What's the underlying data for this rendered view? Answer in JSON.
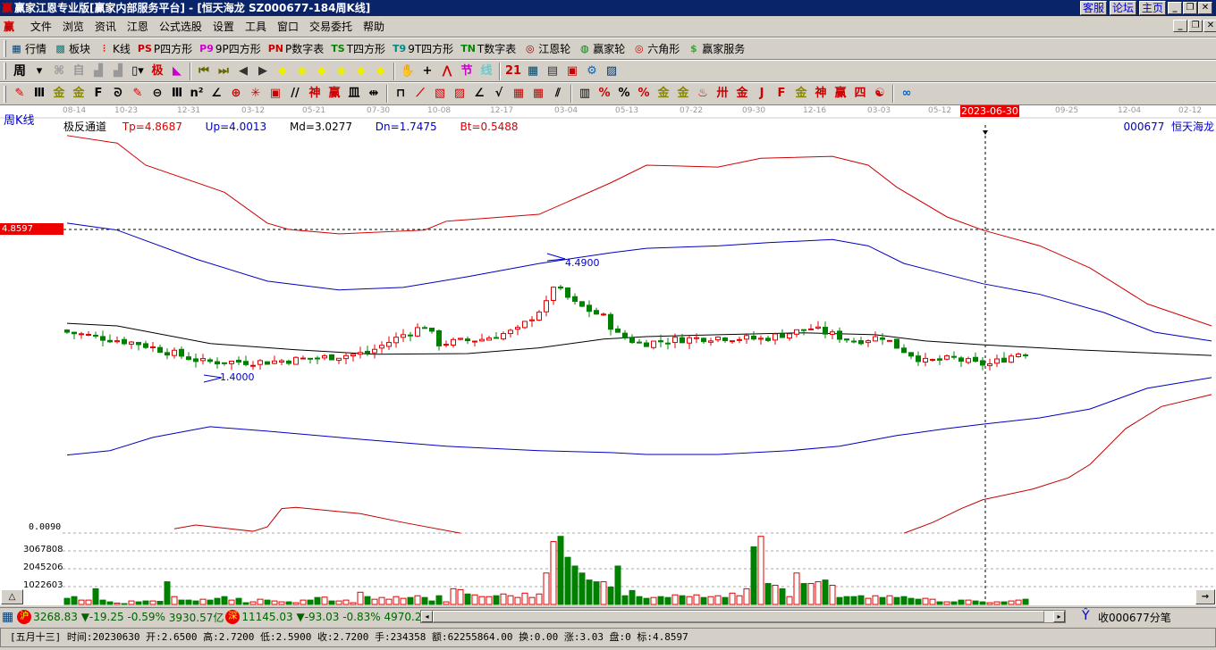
{
  "window": {
    "title": "赢家江恩专业版[赢家内部服务平台] - [恒天海龙   SZ000677-184周K线]",
    "logo": "赢",
    "links": [
      "客服",
      "论坛",
      "主页"
    ]
  },
  "menu": [
    "文件",
    "浏览",
    "资讯",
    "江恩",
    "公式选股",
    "设置",
    "工具",
    "窗口",
    "交易委托",
    "帮助"
  ],
  "toolbar1": [
    {
      "icon": "grid-table-icon",
      "glyph": "▦",
      "color": "#004080",
      "label": "行情"
    },
    {
      "icon": "blocks-icon",
      "glyph": "▩",
      "color": "#008080",
      "label": "板块"
    },
    {
      "icon": "candlestick-icon",
      "glyph": "⫶",
      "color": "#d00",
      "label": "K线"
    },
    {
      "icon": "ps-icon",
      "glyph": "PS",
      "color": "#c00",
      "label": "P四方形"
    },
    {
      "icon": "p9-icon",
      "glyph": "P9",
      "color": "#c0c",
      "label": "9P四方形"
    },
    {
      "icon": "pn-icon",
      "glyph": "PN",
      "color": "#c00",
      "label": "P数字表"
    },
    {
      "icon": "ts-icon",
      "glyph": "TS",
      "color": "#080",
      "label": "T四方形"
    },
    {
      "icon": "t9-icon",
      "glyph": "T9",
      "color": "#088",
      "label": "9T四方形"
    },
    {
      "icon": "tn-icon",
      "glyph": "TN",
      "color": "#080",
      "label": "T数字表"
    },
    {
      "icon": "gann-wheel-icon",
      "glyph": "◎",
      "color": "#800",
      "label": "江恩轮"
    },
    {
      "icon": "winner-wheel-icon",
      "glyph": "◍",
      "color": "#080",
      "label": "赢家轮"
    },
    {
      "icon": "hexagon-icon",
      "glyph": "◎",
      "color": "#c00",
      "label": "六角形"
    },
    {
      "icon": "dollar-icon",
      "glyph": "$",
      "color": "#3a3",
      "label": "赢家服务"
    }
  ],
  "toolbar2": {
    "period": "周",
    "icons": [
      {
        "icon": "dropdown-arrow-icon",
        "glyph": "▾",
        "color": "#000"
      },
      {
        "icon": "pattern-icon",
        "glyph": "⌘",
        "color": "#999"
      },
      {
        "icon": "self-icon",
        "glyph": "自",
        "color": "#999"
      },
      {
        "icon": "bars3-icon",
        "glyph": "▟",
        "color": "#999"
      },
      {
        "icon": "bars9-icon",
        "glyph": "▟",
        "color": "#999"
      },
      {
        "icon": "candle-type-icon",
        "glyph": "▯▾",
        "color": "#000"
      },
      {
        "icon": "extreme-icon",
        "glyph": "极",
        "color": "#c00"
      },
      {
        "icon": "gradient-flag-icon",
        "glyph": "◣",
        "color": "#c0c"
      },
      {
        "icon": "first-icon",
        "glyph": "⏮",
        "color": "#660"
      },
      {
        "icon": "last-icon",
        "glyph": "⏭",
        "color": "#660"
      },
      {
        "icon": "left-icon",
        "glyph": "◀",
        "color": "#333"
      },
      {
        "icon": "right-icon",
        "glyph": "▶",
        "color": "#333"
      },
      {
        "icon": "diamond-left-icon",
        "glyph": "◆",
        "color": "#ee0"
      },
      {
        "icon": "diamond-right-icon",
        "glyph": "◆",
        "color": "#ee0"
      },
      {
        "icon": "diamond-up-icon",
        "glyph": "◆",
        "color": "#ee0"
      },
      {
        "icon": "diamond-in-icon",
        "glyph": "◆",
        "color": "#ee0"
      },
      {
        "icon": "diamond-out-icon",
        "glyph": "◆",
        "color": "#ee0"
      },
      {
        "icon": "diamond-all-icon",
        "glyph": "◆",
        "color": "#ee0"
      },
      {
        "icon": "hand-icon",
        "glyph": "✋",
        "color": "#333"
      },
      {
        "icon": "crosshair-icon",
        "glyph": "+",
        "color": "#000"
      },
      {
        "icon": "zigzag-icon",
        "glyph": "⋀",
        "color": "#c00"
      },
      {
        "icon": "section-icon",
        "glyph": "节",
        "color": "#c0c"
      },
      {
        "icon": "line-icon",
        "glyph": "线",
        "color": "#6cc"
      },
      {
        "icon": "calendar-icon",
        "glyph": "21",
        "color": "#c00"
      },
      {
        "icon": "calculator-icon",
        "glyph": "▦",
        "color": "#046"
      },
      {
        "icon": "notes-icon",
        "glyph": "▤",
        "color": "#333"
      },
      {
        "icon": "save-icon",
        "glyph": "▣",
        "color": "#c00"
      },
      {
        "icon": "network-icon",
        "glyph": "⚙",
        "color": "#06c"
      },
      {
        "icon": "print-icon",
        "glyph": "▨",
        "color": "#036"
      }
    ]
  },
  "toolbar3": [
    {
      "icon": "pen-icon",
      "glyph": "✎",
      "color": "#c00"
    },
    {
      "icon": "vlines-icon",
      "glyph": "Ⅲ",
      "color": "#000"
    },
    {
      "icon": "gold1-icon",
      "glyph": "金",
      "color": "#880"
    },
    {
      "icon": "gold2-icon",
      "glyph": "金",
      "color": "#880"
    },
    {
      "icon": "f-icon",
      "glyph": "F",
      "color": "#000"
    },
    {
      "icon": "spiral-icon",
      "glyph": "ᘐ",
      "color": "#000"
    },
    {
      "icon": "pen2-icon",
      "glyph": "✎",
      "color": "#c00"
    },
    {
      "icon": "circle-icon",
      "glyph": "⊖",
      "color": "#000"
    },
    {
      "icon": "vlines2-icon",
      "glyph": "Ⅲ",
      "color": "#000"
    },
    {
      "icon": "n2-icon",
      "glyph": "n²",
      "color": "#000"
    },
    {
      "icon": "angle-icon",
      "glyph": "∠",
      "color": "#000"
    },
    {
      "icon": "target-icon",
      "glyph": "⊕",
      "color": "#c00"
    },
    {
      "icon": "star-icon",
      "glyph": "✳",
      "color": "#c00"
    },
    {
      "icon": "box-icon",
      "glyph": "▣",
      "color": "#c00"
    },
    {
      "icon": "slash-icon",
      "glyph": "//",
      "color": "#000"
    },
    {
      "icon": "god-icon",
      "glyph": "神",
      "color": "#c00"
    },
    {
      "icon": "win-icon",
      "glyph": "赢",
      "color": "#c00"
    },
    {
      "icon": "comb-icon",
      "glyph": "皿",
      "color": "#000"
    },
    {
      "icon": "width-icon",
      "glyph": "⇹",
      "color": "#000"
    },
    {
      "icon": "frame-icon",
      "glyph": "⊓",
      "color": "#000"
    },
    {
      "icon": "fan-icon",
      "glyph": "⟋",
      "color": "#c00"
    },
    {
      "icon": "fan-box-icon",
      "glyph": "▧",
      "color": "#c00"
    },
    {
      "icon": "fan-box2-icon",
      "glyph": "▨",
      "color": "#c00"
    },
    {
      "icon": "fan-lines-icon",
      "glyph": "∠",
      "color": "#000"
    },
    {
      "icon": "v-icon",
      "glyph": "√",
      "color": "#000"
    },
    {
      "icon": "grid-icon",
      "glyph": "▦",
      "color": "#c00"
    },
    {
      "icon": "grid2-icon",
      "glyph": "▦",
      "color": "#c00"
    },
    {
      "icon": "parallel-icon",
      "glyph": "⫽",
      "color": "#000"
    },
    {
      "icon": "table-icon",
      "glyph": "▥",
      "color": "#000"
    },
    {
      "icon": "percent-slash-icon",
      "glyph": "%",
      "color": "#c00"
    },
    {
      "icon": "percent-icon",
      "glyph": "%",
      "color": "#000"
    },
    {
      "icon": "percent-lines-icon",
      "glyph": "%",
      "color": "#c00"
    },
    {
      "icon": "gold-circle-icon",
      "glyph": "金",
      "color": "#880"
    },
    {
      "icon": "gold-lines-icon",
      "glyph": "金",
      "color": "#880"
    },
    {
      "icon": "fire-icon",
      "glyph": "♨",
      "color": "#c00"
    },
    {
      "icon": "gann-box-icon",
      "glyph": "卅",
      "color": "#c00"
    },
    {
      "icon": "gold-box-icon",
      "glyph": "金",
      "color": "#c00"
    },
    {
      "icon": "j-fan-icon",
      "glyph": "J",
      "color": "#c00"
    },
    {
      "icon": "f-fan-icon",
      "glyph": "F",
      "color": "#c00"
    },
    {
      "icon": "gold-fan-icon",
      "glyph": "金",
      "color": "#880"
    },
    {
      "icon": "god-fan-icon",
      "glyph": "神",
      "color": "#c00"
    },
    {
      "icon": "win-fan-icon",
      "glyph": "赢",
      "color": "#c00"
    },
    {
      "icon": "four-fan-icon",
      "glyph": "四",
      "color": "#c00"
    },
    {
      "icon": "taiji-icon",
      "glyph": "☯",
      "color": "#c00"
    },
    {
      "icon": "infinity-icon",
      "glyph": "∞",
      "color": "#06c"
    }
  ],
  "chart": {
    "period_label": "周K线",
    "indicator": {
      "name": "极反通道",
      "tp": "Tp=4.8687",
      "up": "Up=4.0013",
      "md": "Md=3.0277",
      "dn": "Dn=1.7475",
      "bt": "Bt=0.5488"
    },
    "stock_label": "000677  恒天海龙",
    "cursor_date": "2023-06-30",
    "cursor_price": "4.8597",
    "high_annotation": "4.4900",
    "low_annotation": "1.4000",
    "axis_bottom_label": "0.0090",
    "volume_labels": [
      "3067808",
      "2045206",
      "1022603"
    ],
    "dates": [
      "08-14",
      "10-23",
      "12-31",
      "03-12",
      "05-21",
      "07-30",
      "10-08",
      "12-17",
      "03-04",
      "05-13",
      "07-22",
      "09-30",
      "12-16",
      "03-03",
      "05-12",
      "2023-06-30",
      "09-25",
      "12-04",
      "02-12"
    ],
    "colors": {
      "up": "#e00000",
      "down": "#008000",
      "tp": "#d00000",
      "up_band": "#0000c0",
      "md": "#000000",
      "dn": "#0000c0",
      "bt": "#c00000"
    }
  },
  "chart_data": {
    "type": "candlestick",
    "x_unit": "week index",
    "weeks": 135,
    "price_ylim": [
      0,
      6.5
    ],
    "close_keys": [
      [
        0,
        3.23
      ],
      [
        10,
        3.05
      ],
      [
        19,
        2.76
      ],
      [
        28,
        2.76
      ],
      [
        36,
        2.83
      ],
      [
        42,
        2.9
      ],
      [
        47,
        3.19
      ],
      [
        50,
        3.33
      ],
      [
        52,
        3.05
      ],
      [
        58,
        3.12
      ],
      [
        63,
        3.26
      ],
      [
        67,
        3.68
      ],
      [
        68,
        3.97
      ],
      [
        71,
        3.68
      ],
      [
        75,
        3.47
      ],
      [
        77,
        3.19
      ],
      [
        80,
        3.05
      ],
      [
        86,
        3.12
      ],
      [
        91,
        3.15
      ],
      [
        97,
        3.12
      ],
      [
        104,
        3.29
      ],
      [
        110,
        3.09
      ],
      [
        114,
        3.16
      ],
      [
        116,
        3.0
      ],
      [
        120,
        2.76
      ],
      [
        124,
        2.81
      ],
      [
        127,
        2.73
      ],
      [
        129,
        2.72
      ],
      [
        133,
        2.9
      ],
      [
        134,
        2.9
      ]
    ],
    "series": [
      {
        "name": "Tp",
        "points": [
          [
            0,
            6.35
          ],
          [
            7,
            6.23
          ],
          [
            11,
            5.88
          ],
          [
            22,
            5.45
          ],
          [
            28,
            4.96
          ],
          [
            31,
            4.86
          ],
          [
            38,
            4.79
          ],
          [
            50,
            4.85
          ],
          [
            53,
            4.99
          ],
          [
            66,
            5.1
          ],
          [
            76,
            5.6
          ],
          [
            81,
            5.88
          ],
          [
            91,
            5.85
          ],
          [
            97,
            5.99
          ],
          [
            107,
            6.02
          ],
          [
            112,
            5.88
          ],
          [
            116,
            5.53
          ],
          [
            123,
            5.06
          ],
          [
            128,
            4.85
          ],
          [
            136,
            4.6
          ],
          [
            143,
            4.25
          ],
          [
            151,
            3.68
          ],
          [
            160,
            3.33
          ]
        ]
      },
      {
        "name": "Up",
        "points": [
          [
            0,
            4.96
          ],
          [
            7,
            4.85
          ],
          [
            18,
            4.39
          ],
          [
            28,
            4.04
          ],
          [
            38,
            3.9
          ],
          [
            47,
            3.94
          ],
          [
            56,
            4.11
          ],
          [
            66,
            4.32
          ],
          [
            76,
            4.49
          ],
          [
            81,
            4.56
          ],
          [
            91,
            4.6
          ],
          [
            98,
            4.65
          ],
          [
            107,
            4.7
          ],
          [
            112,
            4.6
          ],
          [
            117,
            4.32
          ],
          [
            128,
            4.0
          ],
          [
            136,
            3.83
          ],
          [
            145,
            3.54
          ],
          [
            152,
            3.23
          ],
          [
            160,
            3.09
          ]
        ]
      },
      {
        "name": "Md",
        "points": [
          [
            0,
            3.37
          ],
          [
            7,
            3.33
          ],
          [
            20,
            3.05
          ],
          [
            32,
            2.95
          ],
          [
            43,
            2.88
          ],
          [
            56,
            2.89
          ],
          [
            66,
            2.98
          ],
          [
            75,
            3.12
          ],
          [
            81,
            3.16
          ],
          [
            91,
            3.19
          ],
          [
            103,
            3.22
          ],
          [
            113,
            3.19
          ],
          [
            120,
            3.09
          ],
          [
            128,
            3.03
          ],
          [
            141,
            2.95
          ],
          [
            160,
            2.86
          ]
        ]
      },
      {
        "name": "Dn",
        "points": [
          [
            0,
            1.28
          ],
          [
            6,
            1.35
          ],
          [
            12,
            1.56
          ],
          [
            20,
            1.73
          ],
          [
            28,
            1.66
          ],
          [
            41,
            1.53
          ],
          [
            53,
            1.42
          ],
          [
            66,
            1.35
          ],
          [
            76,
            1.32
          ],
          [
            81,
            1.29
          ],
          [
            91,
            1.29
          ],
          [
            101,
            1.35
          ],
          [
            108,
            1.42
          ],
          [
            116,
            1.59
          ],
          [
            123,
            1.7
          ],
          [
            128,
            1.77
          ],
          [
            136,
            1.87
          ],
          [
            143,
            2.01
          ],
          [
            151,
            2.34
          ],
          [
            160,
            2.51
          ]
        ]
      },
      {
        "name": "Bt",
        "points": [
          [
            15,
            0.11
          ],
          [
            18,
            0.17
          ],
          [
            26,
            0.07
          ],
          [
            28,
            0.14
          ],
          [
            30,
            0.43
          ],
          [
            32,
            0.45
          ],
          [
            41,
            0.35
          ],
          [
            47,
            0.21
          ],
          [
            55,
            0.04
          ],
          null,
          [
            117,
            0.04
          ],
          [
            121,
            0.21
          ],
          [
            125,
            0.43
          ],
          [
            128,
            0.57
          ],
          [
            135,
            0.74
          ],
          [
            140,
            0.92
          ],
          [
            143,
            1.13
          ],
          [
            148,
            1.7
          ],
          [
            153,
            2.05
          ],
          [
            160,
            2.24
          ]
        ]
      }
    ],
    "volume_k": [
      350,
      450,
      250,
      250,
      900,
      250,
      150,
      80,
      50,
      200,
      150,
      200,
      200,
      180,
      1300,
      450,
      250,
      250,
      200,
      300,
      250,
      350,
      450,
      250,
      350,
      100,
      150,
      300,
      250,
      200,
      150,
      150,
      100,
      250,
      250,
      400,
      420,
      200,
      200,
      250,
      100,
      700,
      450,
      300,
      400,
      300,
      450,
      350,
      400,
      500,
      400,
      200,
      500,
      150,
      900,
      850,
      600,
      550,
      450,
      450,
      500,
      600,
      500,
      400,
      650,
      400,
      600,
      1800,
      3600,
      3900,
      2700,
      2200,
      1800,
      1400,
      1300,
      1300,
      1000,
      2200,
      500,
      800,
      450,
      350,
      400,
      450,
      400,
      550,
      500,
      450,
      550,
      400,
      450,
      500,
      400,
      650,
      500,
      900,
      3300,
      3900,
      1200,
      1100,
      900,
      450,
      1800,
      1200,
      1200,
      1300,
      1400,
      1100,
      400,
      450,
      450,
      500,
      350,
      500,
      400,
      500,
      400,
      450,
      350,
      300,
      350,
      300,
      150,
      150,
      150,
      250,
      250,
      200,
      150,
      100,
      150,
      150,
      200,
      250,
      300
    ]
  },
  "status": {
    "sh_badge": "沪",
    "sh_index": "3268.83",
    "sh_change": "▼-19.25",
    "sh_pct": "-0.59%",
    "sh_amount": "3930.57亿",
    "sz_badge": "深",
    "sz_index": "11145.03",
    "sz_change": "▼-93.03",
    "sz_pct": "-0.83%",
    "sz_amount": "4970.2",
    "receive": "收000677分笔"
  },
  "bar_info": "[五月十三] 时间:20230630 开:2.6500 高:2.7200 低:2.5900 收:2.7200 手:234358 额:62255864.00 换:0.00 涨:3.03 盘:0 标:4.8597",
  "buttons": {
    "up_arrow": "△",
    "right_arrow": "→"
  }
}
